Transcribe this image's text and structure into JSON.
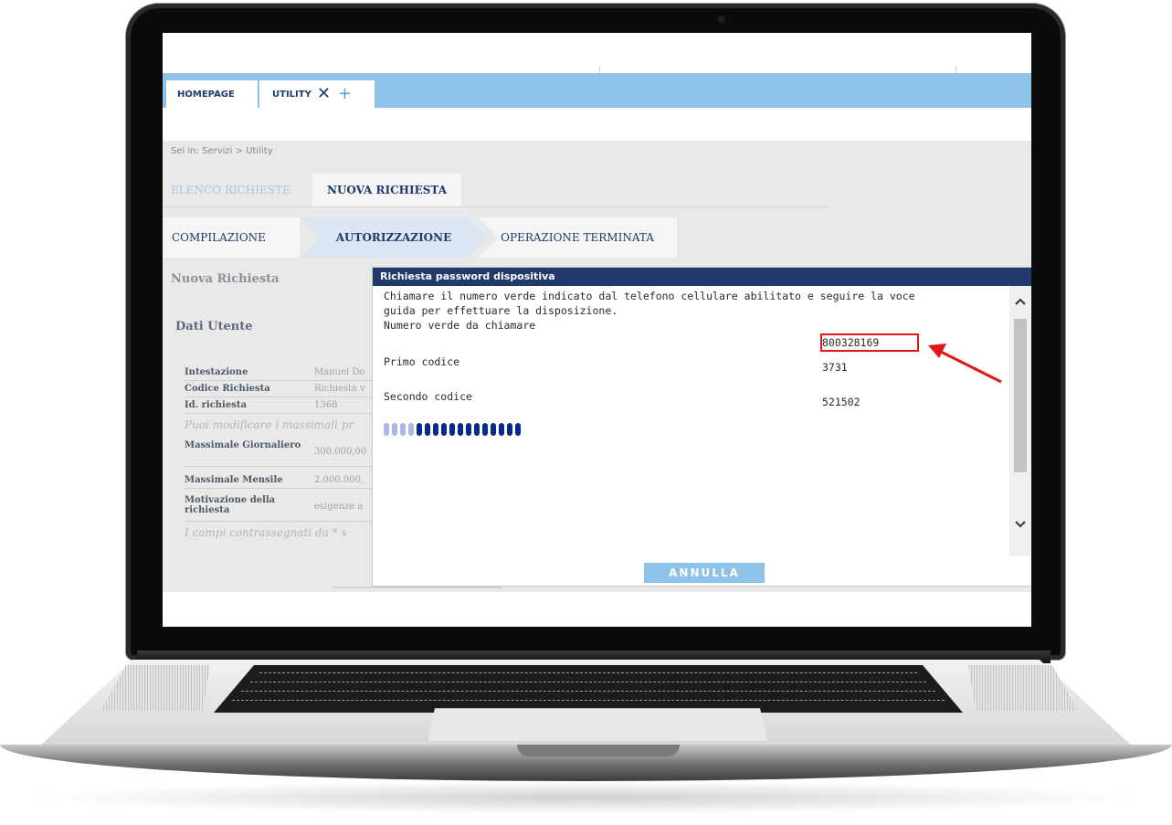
{
  "tabs": {
    "home": "HOMEPAGE",
    "utility": "UTILITY",
    "close_glyph": "✕",
    "add_glyph": "+"
  },
  "breadcrumb": "Sei in:  Servizi  >  Utility",
  "subtabs": {
    "list": "ELENCO RICHIESTE",
    "new": "NUOVA RICHIESTA"
  },
  "steps": {
    "step1": "COMPILAZIONE",
    "step2": "AUTORIZZAZIONE",
    "step3": "OPERAZIONE TERMINATA"
  },
  "form": {
    "section_title": "Nuova Richiesta",
    "user_title": "Dati Utente",
    "rows": [
      {
        "label": "Intestazione",
        "value": "Manuel Do"
      },
      {
        "label": "Codice Richiesta",
        "value": "Richiesta v"
      },
      {
        "label": "Id. richiesta",
        "value": "1368"
      },
      {
        "label": "Massimale Giornaliero",
        "value": "300.000,00"
      },
      {
        "label": "Massimale Mensile",
        "value": "2.000.000,"
      },
      {
        "label": "Motivazione della richiesta",
        "value": "esigenze a"
      }
    ],
    "note_modify": "Puoi modificare i massimali pr",
    "note_required": "I campi contrassegnati da * s"
  },
  "modal": {
    "title": "Richiesta password dispositiva",
    "instruction_line1": "Chiamare il numero verde indicato dal telefono cellulare abilitato e seguire la voce",
    "instruction_line2": "guida per effettuare la disposizione.",
    "number_label": "Numero verde da chiamare",
    "number_value": "800328169",
    "first_code_label": "Primo codice",
    "first_code_value": "3731",
    "second_code_label": "Secondo codice",
    "second_code_value": "521502",
    "cancel_button": "ANNULLA",
    "progress_total_segments": 17,
    "progress_filled_segments": 13
  },
  "colors": {
    "brand_dark": "#1f3a6b",
    "brand_light": "#8ec3e8",
    "highlight": "#e01818",
    "progress_filled": "#0a2a8a",
    "progress_empty": "#aab8e8"
  },
  "icons": {
    "scroll_up": "chevron-up-icon",
    "scroll_down": "chevron-down-icon",
    "annotation": "arrow-icon"
  }
}
